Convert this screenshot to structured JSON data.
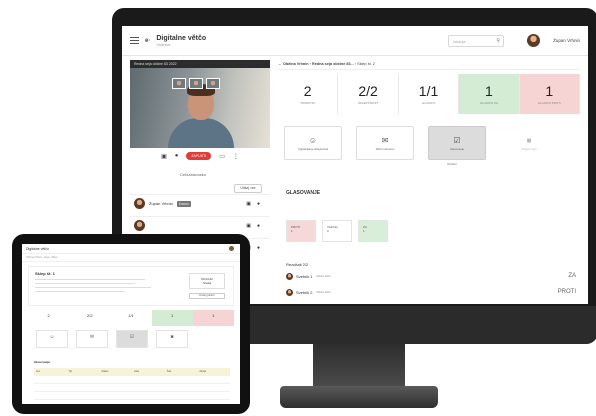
{
  "monitor": {
    "header": {
      "menu_icon": "hamburger-icon",
      "logo_text": "e·",
      "title": "Digitalne větčo",
      "subtitle": "Vodnice",
      "search_placeholder": "Iskanje ...",
      "user_name": "Župan Vrhnin"
    },
    "video": {
      "bar_text": "Redna seja občine 83 2022",
      "controls": [
        "cam-icon",
        "mic-icon",
        "screen-icon",
        "more-icon"
      ],
      "end_call_label": "ZAPUSTI",
      "fullscreen_label": "Celozaslonsko",
      "mute_all_label": "Utišaj vse"
    },
    "participants": [
      {
        "name": "Župan Vrhnin",
        "tag": "ŽUPAN"
      }
    ],
    "breadcrumb": {
      "parts": [
        "Občina Vrhnin",
        "Redna seja občine 83...",
        "Sklep št. 2"
      ]
    },
    "stats": [
      {
        "value": "2",
        "label": "Prisotni",
        "state": "neutral"
      },
      {
        "value": "2/2",
        "label": "Sklepčnost",
        "state": "neutral"
      },
      {
        "value": "1/1",
        "label": "Glasovi",
        "state": "neutral"
      },
      {
        "value": "1",
        "label": "Glasovi ZA",
        "state": "ok"
      },
      {
        "value": "1",
        "label": "Glasovi PROTI",
        "state": "bad"
      }
    ],
    "actions": [
      {
        "label": "Ugotavljanje sklepčnosti",
        "state": "normal"
      },
      {
        "label": "Začni razpravo",
        "state": "normal"
      },
      {
        "label": "Glasovanje",
        "state": "active"
      },
      {
        "label": "Zaključi sejo",
        "state": "disabled"
      }
    ],
    "action_sub": "Prekini",
    "voting": {
      "title": "GLASOVANJE",
      "boxes": [
        {
          "label": "PROTI",
          "value": "1",
          "color": "red"
        },
        {
          "label": "Vzdržan",
          "value": "0",
          "color": "none"
        },
        {
          "label": "ZA",
          "value": "1",
          "color": "green"
        }
      ],
      "results_head": "Rezultati 2/2",
      "rows": [
        {
          "name": "Svetnik 1",
          "desc": "Redni član",
          "result": "ZA"
        },
        {
          "name": "Svetnik 2",
          "desc": "Redni član",
          "result": "PROTI"
        }
      ]
    }
  },
  "tablet": {
    "header_title": "Digitalne větčo",
    "breadcrumb": "Občina Vrhnin › Seja › Sklep",
    "card": {
      "title": "Sklep št. 1",
      "date": "09.04.22",
      "date_sub": "Sreda",
      "button_label": "Dodaj gradivo"
    },
    "stats": [
      {
        "value": "2",
        "state": "neutral"
      },
      {
        "value": "2/2",
        "state": "neutral"
      },
      {
        "value": "1/1",
        "state": "neutral"
      },
      {
        "value": "1",
        "state": "ok"
      },
      {
        "value": "1",
        "state": "bad"
      }
    ],
    "section_title": "Glasovanje",
    "table_head": [
      "Ime",
      "Tip",
      "Status",
      "Glas",
      "Čas",
      "Akcija"
    ]
  },
  "colors": {
    "ok": "#d4ecd4",
    "bad": "#f6d4d4",
    "end_call": "#e03c3c"
  }
}
